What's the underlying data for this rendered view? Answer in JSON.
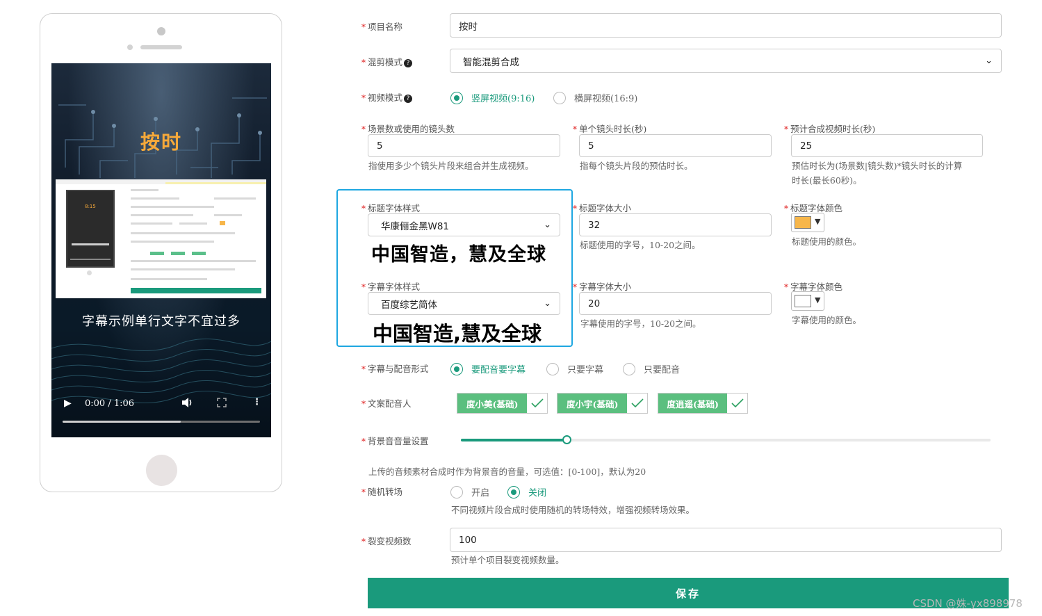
{
  "preview": {
    "video_title": "按时",
    "subtitle": "字幕示例单行文字不宜过多",
    "inner_time": "8:15",
    "time_current": "0:00",
    "time_separator": "/",
    "time_total": "1:06",
    "progress": 0.6
  },
  "form": {
    "project_name": {
      "label": "项目名称",
      "value": "按时"
    },
    "mix_mode": {
      "label": "混剪模式",
      "value": "智能混剪合成"
    },
    "video_mode": {
      "label": "视频模式",
      "options": [
        {
          "label": "竖屏视频(9:16)",
          "selected": true
        },
        {
          "label": "横屏视频(16:9)",
          "selected": false
        }
      ]
    },
    "scene_count": {
      "label": "场景数或使用的镜头数",
      "value": "5",
      "hint": "指使用多少个镜头片段来组合并生成视频。"
    },
    "clip_duration": {
      "label": "单个镜头时长(秒)",
      "value": "5",
      "hint": "指每个镜头片段的预估时长。"
    },
    "total_duration": {
      "label": "预计合成视频时长(秒)",
      "value": "25",
      "hint1": "预估时长为(场景数|镜头数)*镜头时长的计算",
      "hint2": "时长(最长60秒)。"
    },
    "title_font": {
      "label": "标题字体样式",
      "value": "华康俪金黑W81",
      "preview": "中国智造，慧及全球"
    },
    "title_size": {
      "label": "标题字体大小",
      "value": "32",
      "hint": "标题使用的字号，10-20之间。"
    },
    "title_color": {
      "label": "标题字体颜色",
      "color": "#f7b64a",
      "hint": "标题使用的颜色。"
    },
    "subtitle_font": {
      "label": "字幕字体样式",
      "value": "百度综艺简体",
      "preview": "中国智造,慧及全球"
    },
    "subtitle_size": {
      "label": "字幕字体大小",
      "value": "20",
      "hint": "字幕使用的字号，10-20之间。"
    },
    "subtitle_color": {
      "label": "字幕字体颜色",
      "color": "#ffffff",
      "hint": "字幕使用的颜色。"
    },
    "sub_audio_mode": {
      "label": "字幕与配音形式",
      "options": [
        {
          "label": "要配音要字幕",
          "selected": true
        },
        {
          "label": "只要字幕",
          "selected": false
        },
        {
          "label": "只要配音",
          "selected": false
        }
      ]
    },
    "voice": {
      "label": "文案配音人",
      "items": [
        {
          "label": "度小美(基础)"
        },
        {
          "label": "度小宇(基础)"
        },
        {
          "label": "度逍遥(基础)"
        }
      ]
    },
    "bg_volume": {
      "label": "背景音音量设置",
      "value": 20,
      "min": 0,
      "max": 100,
      "hint": "上传的音频素材合成时作为背景音的音量，可选值：[0-100]，默认为20"
    },
    "random_transition": {
      "label": "随机转场",
      "options": [
        {
          "label": "开启",
          "selected": false
        },
        {
          "label": "关闭",
          "selected": true
        }
      ],
      "hint": "不同视频片段合成时使用随机的转场特效，增强视频转场效果。"
    },
    "variant_count": {
      "label": "裂变视频数",
      "value": "100",
      "hint": "预计单个项目裂变视频数量。"
    },
    "save_label": "保存"
  },
  "watermark": "CSDN @姝-yx898978",
  "colors": {
    "accent": "#1a9a7c",
    "voice_green": "#5bbf7f",
    "required": "#e02020",
    "highlight": "#1ea7e1"
  }
}
